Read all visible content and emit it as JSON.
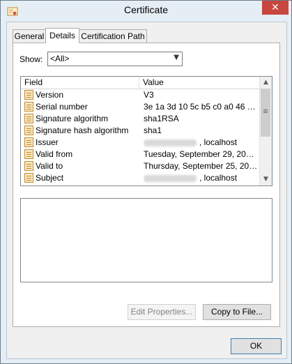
{
  "window": {
    "title": "Certificate",
    "close_glyph": "✕"
  },
  "tabs": [
    {
      "label": "General"
    },
    {
      "label": "Details"
    },
    {
      "label": "Certification Path"
    }
  ],
  "show": {
    "label": "Show:",
    "selected": "<All>"
  },
  "list": {
    "columns": {
      "field": "Field",
      "value": "Value"
    },
    "rows": [
      {
        "field": "Version",
        "value": "V3"
      },
      {
        "field": "Serial number",
        "value": "3e 1a 3d 10 5c b5 c0 a0 46 ed..."
      },
      {
        "field": "Signature algorithm",
        "value": "sha1RSA"
      },
      {
        "field": "Signature hash algorithm",
        "value": "sha1"
      },
      {
        "field": "Issuer",
        "value": ", localhost"
      },
      {
        "field": "Valid from",
        "value": "Tuesday, September 29, 2015..."
      },
      {
        "field": "Valid to",
        "value": "Thursday, September 25, 202..."
      },
      {
        "field": "Subject",
        "value": ", localhost"
      }
    ]
  },
  "buttons": {
    "edit_properties": "Edit Properties...",
    "copy_to_file": "Copy to File...",
    "ok": "OK"
  },
  "icons": {
    "title": "certificate-icon",
    "field": "certificate-field-icon"
  }
}
